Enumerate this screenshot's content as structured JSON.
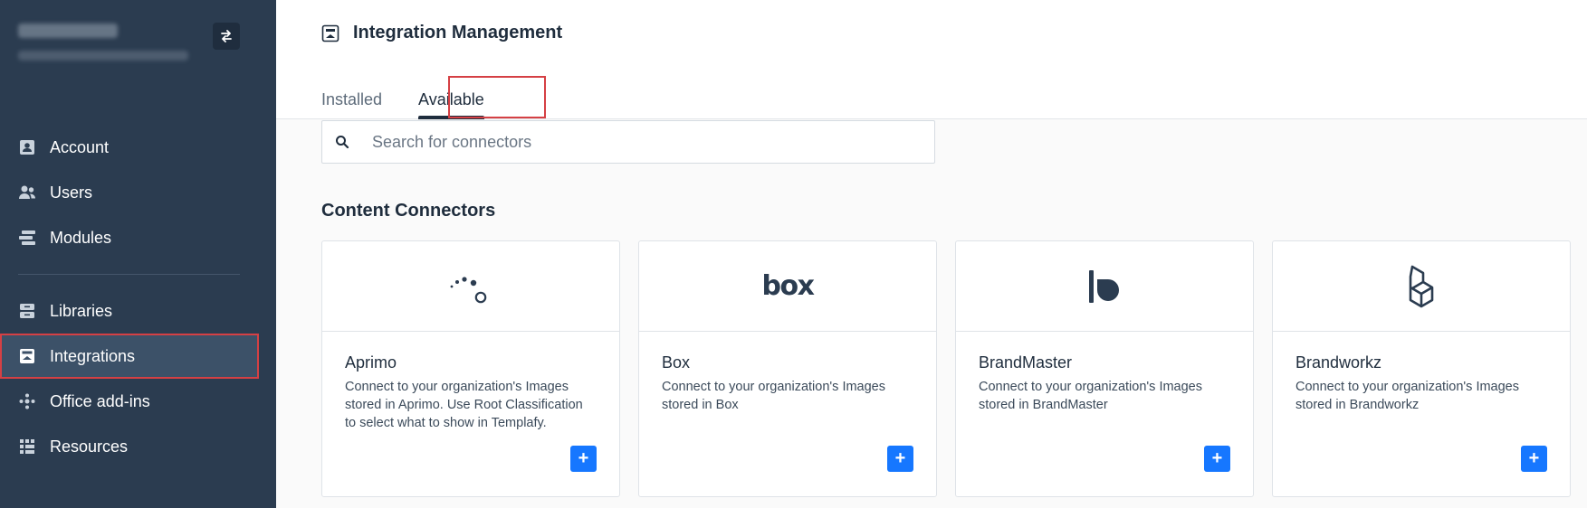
{
  "sidebar": {
    "items": [
      {
        "label": "Account",
        "icon": "account-icon"
      },
      {
        "label": "Users",
        "icon": "users-icon"
      },
      {
        "label": "Modules",
        "icon": "modules-icon"
      },
      {
        "label": "Libraries",
        "icon": "libraries-icon"
      },
      {
        "label": "Integrations",
        "icon": "integrations-icon",
        "active": true
      },
      {
        "label": "Office add-ins",
        "icon": "office-addins-icon"
      },
      {
        "label": "Resources",
        "icon": "resources-icon"
      }
    ]
  },
  "header": {
    "title": "Integration Management",
    "tabs": [
      {
        "label": "Installed",
        "active": false
      },
      {
        "label": "Available",
        "active": true
      }
    ]
  },
  "search": {
    "placeholder": "Search for connectors",
    "value": ""
  },
  "section": {
    "title": "Content Connectors"
  },
  "cards": [
    {
      "name": "Aprimo",
      "description": "Connect to your organization's Images stored in Aprimo. Use Root Classification to select what to show in Templafy.",
      "logo": "aprimo-logo",
      "add": "+"
    },
    {
      "name": "Box",
      "description": "Connect to your organization's Images stored in Box",
      "logo": "box-logo",
      "add": "+",
      "logo_text": "box"
    },
    {
      "name": "BrandMaster",
      "description": "Connect to your organization's Images stored in BrandMaster",
      "logo": "brandmaster-logo",
      "add": "+"
    },
    {
      "name": "Brandworkz",
      "description": "Connect to your organization's Images stored in Brandworkz",
      "logo": "brandworkz-logo",
      "add": "+"
    }
  ],
  "colors": {
    "sidebar_bg": "#2b3c50",
    "active_item_bg": "#3c5168",
    "highlight_border": "#d54044",
    "add_button": "#1677ff",
    "text_dark": "#1f2d3d"
  }
}
